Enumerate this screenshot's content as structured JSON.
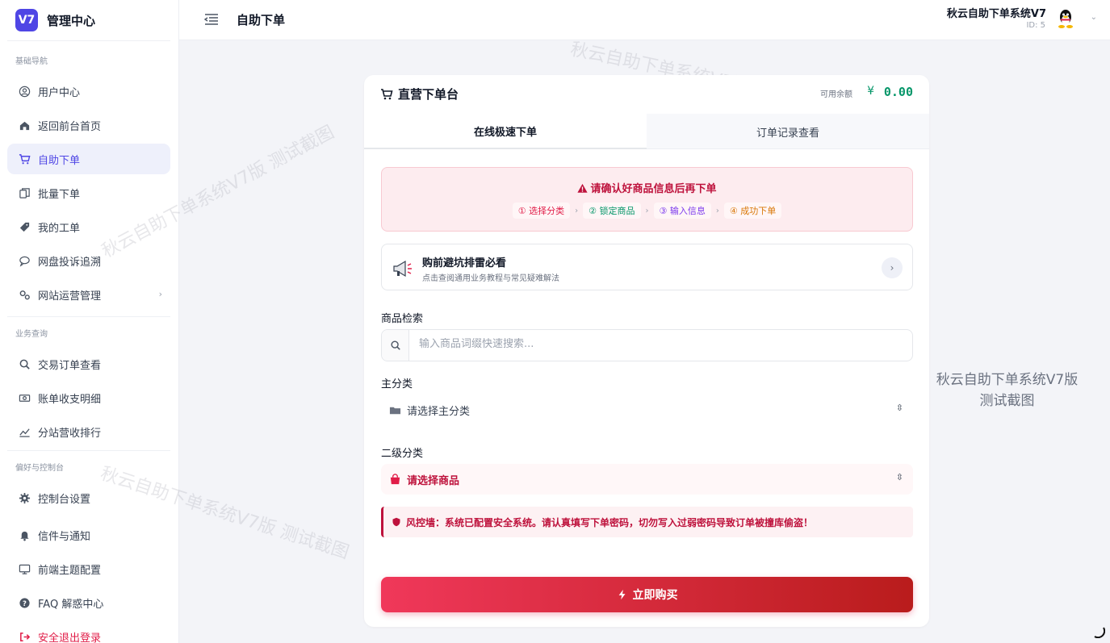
{
  "brand": {
    "logo": "V7",
    "name": "管理中心"
  },
  "sidebar": {
    "groups": [
      {
        "title": "基础导航"
      },
      {
        "title": "业务查询"
      },
      {
        "title": "偏好与控制台"
      }
    ],
    "items": [
      {
        "label": "用户中心",
        "icon": "user-circle-icon"
      },
      {
        "label": "返回前台首页",
        "icon": "home-icon"
      },
      {
        "label": "自助下单",
        "icon": "cart-icon"
      },
      {
        "label": "批量下单",
        "icon": "copy-icon"
      },
      {
        "label": "我的工单",
        "icon": "tag-icon"
      },
      {
        "label": "网盘投诉追溯",
        "icon": "chat-icon"
      },
      {
        "label": "网站运营管理",
        "icon": "cogs-icon"
      },
      {
        "label": "交易订单查看",
        "icon": "search-icon"
      },
      {
        "label": "账单收支明细",
        "icon": "money-icon"
      },
      {
        "label": "分站营收排行",
        "icon": "chart-line-icon"
      },
      {
        "label": "控制台设置",
        "icon": "gear-icon"
      },
      {
        "label": "信件与通知",
        "icon": "bell-icon"
      },
      {
        "label": "前端主题配置",
        "icon": "monitor-icon"
      },
      {
        "label": "FAQ 解惑中心",
        "icon": "question-icon"
      },
      {
        "label": "安全退出登录",
        "icon": "logout-icon"
      }
    ]
  },
  "header": {
    "title": "自助下单",
    "user_name": "秋云自助下单系统V7",
    "user_id": "ID: 5"
  },
  "card": {
    "title": "直营下单台",
    "balance_label": "可用余额",
    "balance_currency": "¥",
    "balance_value": "0.00",
    "tabs": [
      {
        "label": "在线极速下单"
      },
      {
        "label": "订单记录查看"
      }
    ],
    "alert": {
      "title": "请确认好商品信息后再下单",
      "steps": [
        {
          "label": "① 选择分类",
          "color": "#e11d48"
        },
        {
          "label": "② 锁定商品",
          "color": "#059669"
        },
        {
          "label": "③ 输入信息",
          "color": "#7c3aed"
        },
        {
          "label": "④ 成功下单",
          "color": "#d97706"
        }
      ],
      "sep": "›"
    },
    "guide": {
      "title": "购前避坑排雷必看",
      "subtitle": "点击查阅通用业务教程与常见疑难解法"
    },
    "search": {
      "label": "商品检索",
      "placeholder": "输入商品词缀快速搜索..."
    },
    "main_category": {
      "label": "主分类",
      "value": "请选择主分类"
    },
    "sub_category": {
      "label": "二级分类",
      "value": "请选择商品"
    },
    "risk": "风控墙：系统已配置安全系统。请认真填写下单密码，切勿写入过弱密码导致订单被撞库偷盗！",
    "buy_button": "立即购买"
  },
  "watermark": {
    "text": "秋云自助下单系统V7版 测试截图",
    "side_line1": "秋云自助下单系统V7版",
    "side_line2": "测试截图"
  },
  "colors": {
    "accent": "#4f46e5",
    "danger": "#be123c",
    "success": "#059669"
  }
}
